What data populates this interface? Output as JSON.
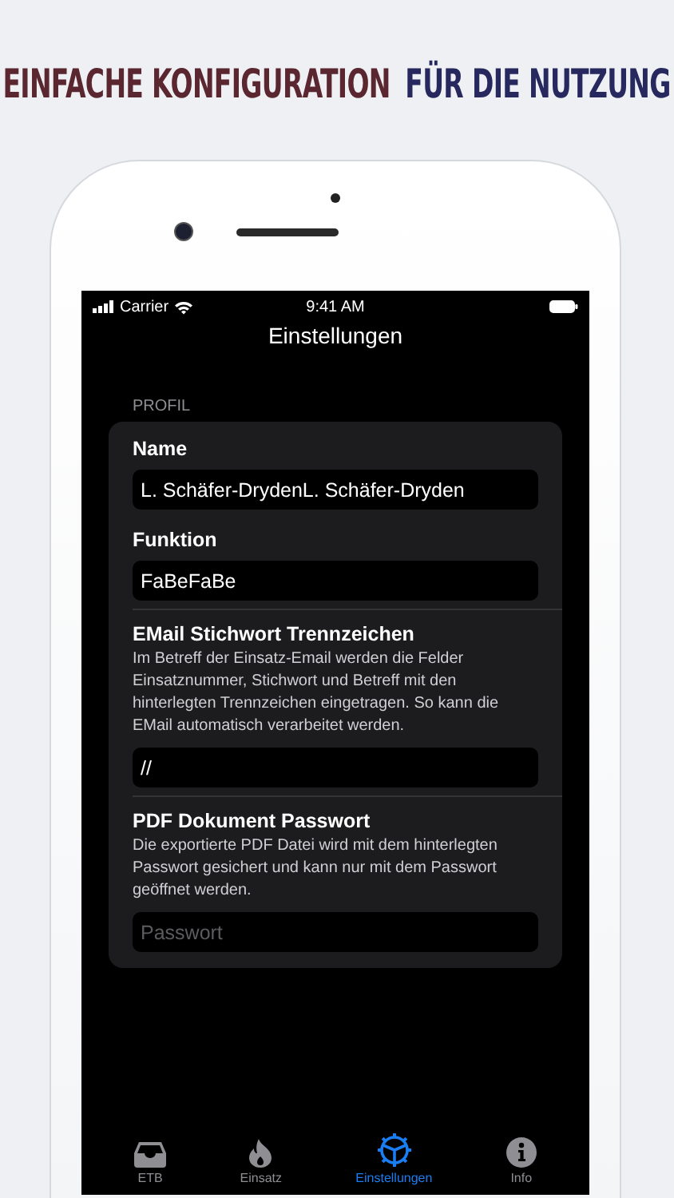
{
  "headline": [
    {
      "text": "EINFACHE KONFIGURATION",
      "color": "#5a2630"
    },
    {
      "text": "FÜR DIE NUTZUNG",
      "color": "#26285e"
    }
  ],
  "status_bar": {
    "carrier": "Carrier",
    "time": "9:41 AM"
  },
  "nav_title": "Einstellungen",
  "section": {
    "header": "PROFIL",
    "fields": [
      {
        "label": "Name",
        "value": "L. Schäfer-DrydenL. Schäfer-Dryden"
      },
      {
        "label": "Funktion",
        "value": "FaBeFaBe"
      },
      {
        "label": "EMail Stichwort Trennzeichen",
        "description": "Im Betreff der Einsatz-Email werden die Felder Einsatznummer, Stichwort und Betreff mit den hinterlegten Trennzeichen eingetragen. So kann die EMail automatisch verarbeitet werden.",
        "value": "//"
      },
      {
        "label": "PDF Dokument Passwort",
        "description": "Die exportierte PDF Datei wird mit dem hinterlegten Passwort gesichert und kann nur mit dem Passwort geöffnet werden.",
        "placeholder": "Passwort"
      }
    ]
  },
  "tabs": [
    {
      "label": "ETB",
      "selected": false
    },
    {
      "label": "Einsatz",
      "selected": false
    },
    {
      "label": "Einstellungen",
      "selected": true
    },
    {
      "label": "Info",
      "selected": false
    }
  ]
}
